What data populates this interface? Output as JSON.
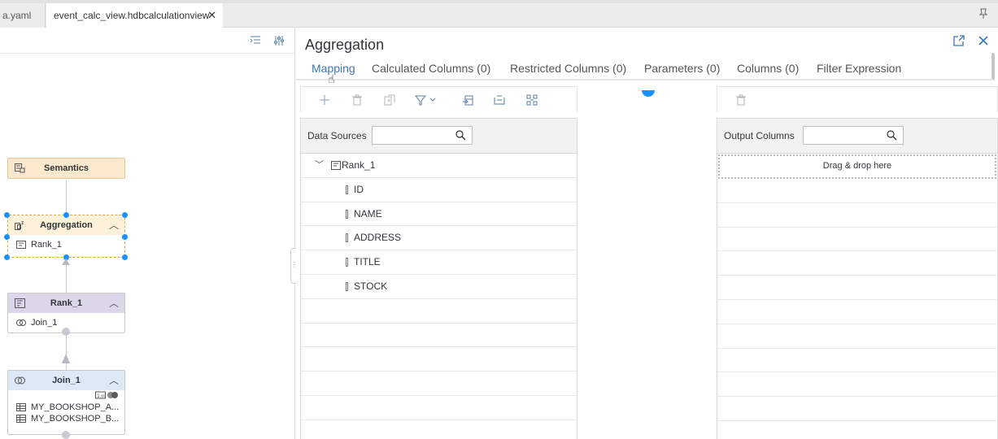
{
  "tabs": {
    "inactive_label": "a.yaml",
    "active_label": "event_calc_view.hdbcalculationview",
    "close_glyph": "✕"
  },
  "graph": {
    "nodes": {
      "semantics": {
        "title": "Semantics",
        "icon": "semantics-icon"
      },
      "aggregation": {
        "title": "Aggregation",
        "child": "Rank_1",
        "icon": "aggregation-icon"
      },
      "rank": {
        "title": "Rank_1",
        "child": "Join_1",
        "icon": "rank-icon"
      },
      "join": {
        "title": "Join_1",
        "children": [
          "MY_BOOKSHOP_A...",
          "MY_BOOKSHOP_B..."
        ],
        "icon": "join-icon"
      }
    },
    "colors": {
      "selection": "#1b90ff",
      "aggregation_border": "#e2a449"
    }
  },
  "panel": {
    "title": "Aggregation",
    "subtabs": [
      "Mapping",
      "Calculated Columns (0)",
      "Restricted Columns (0)",
      "Parameters (0)",
      "Columns (0)",
      "Filter Expression"
    ],
    "active_subtab": "Mapping",
    "accent": "#3a78b5",
    "data_sources": {
      "label": "Data Sources",
      "root": "Rank_1",
      "columns": [
        "ID",
        "NAME",
        "ADDRESS",
        "TITLE",
        "STOCK"
      ]
    },
    "output_columns": {
      "label": "Output Columns",
      "dropzone": "Drag & drop here"
    }
  }
}
